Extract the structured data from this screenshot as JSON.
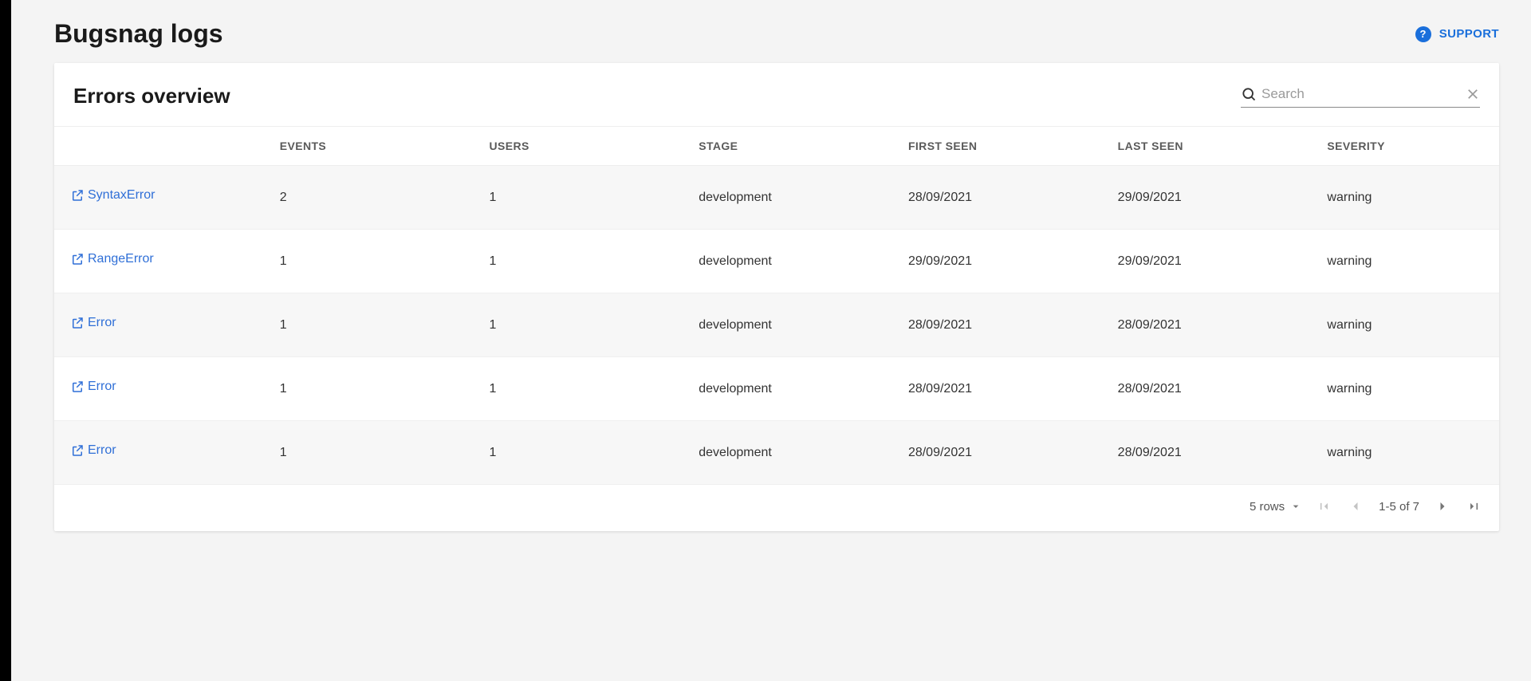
{
  "header": {
    "title": "Bugsnag logs",
    "support_label": "SUPPORT"
  },
  "card": {
    "title": "Errors overview",
    "search_placeholder": "Search"
  },
  "table": {
    "columns": {
      "events": "EVENTS",
      "users": "USERS",
      "stage": "STAGE",
      "first_seen": "FIRST SEEN",
      "last_seen": "LAST SEEN",
      "severity": "SEVERITY"
    },
    "rows": [
      {
        "name": "SyntaxError",
        "events": "2",
        "users": "1",
        "stage": "development",
        "first_seen": "28/09/2021",
        "last_seen": "29/09/2021",
        "severity": "warning"
      },
      {
        "name": "RangeError",
        "events": "1",
        "users": "1",
        "stage": "development",
        "first_seen": "29/09/2021",
        "last_seen": "29/09/2021",
        "severity": "warning"
      },
      {
        "name": "Error",
        "events": "1",
        "users": "1",
        "stage": "development",
        "first_seen": "28/09/2021",
        "last_seen": "28/09/2021",
        "severity": "warning"
      },
      {
        "name": "Error",
        "events": "1",
        "users": "1",
        "stage": "development",
        "first_seen": "28/09/2021",
        "last_seen": "28/09/2021",
        "severity": "warning"
      },
      {
        "name": "Error",
        "events": "1",
        "users": "1",
        "stage": "development",
        "first_seen": "28/09/2021",
        "last_seen": "28/09/2021",
        "severity": "warning"
      }
    ]
  },
  "pagination": {
    "rows_label": "5 rows",
    "range": "1-5 of 7"
  }
}
